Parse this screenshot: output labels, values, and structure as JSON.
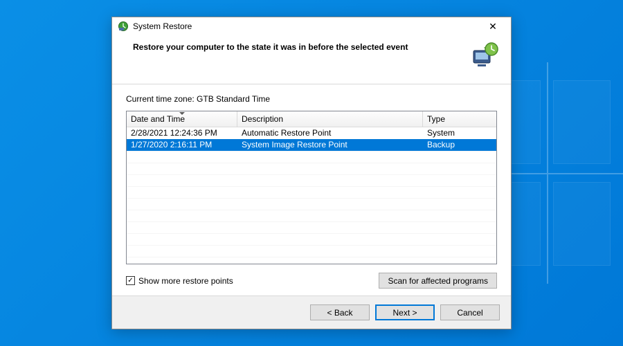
{
  "window": {
    "title": "System Restore"
  },
  "header": {
    "heading": "Restore your computer to the state it was in before the selected event"
  },
  "timezone_label": "Current time zone: GTB Standard Time",
  "table": {
    "columns": {
      "date": "Date and Time",
      "description": "Description",
      "type": "Type"
    },
    "rows": [
      {
        "date": "2/28/2021 12:24:36 PM",
        "description": "Automatic Restore Point",
        "type": "System",
        "selected": false
      },
      {
        "date": "1/27/2020 2:16:11 PM",
        "description": "System Image Restore Point",
        "type": "Backup",
        "selected": true
      }
    ]
  },
  "checkbox": {
    "label": "Show more restore points",
    "checked": true
  },
  "buttons": {
    "scan": "Scan for affected programs",
    "back": "< Back",
    "next": "Next >",
    "cancel": "Cancel"
  }
}
